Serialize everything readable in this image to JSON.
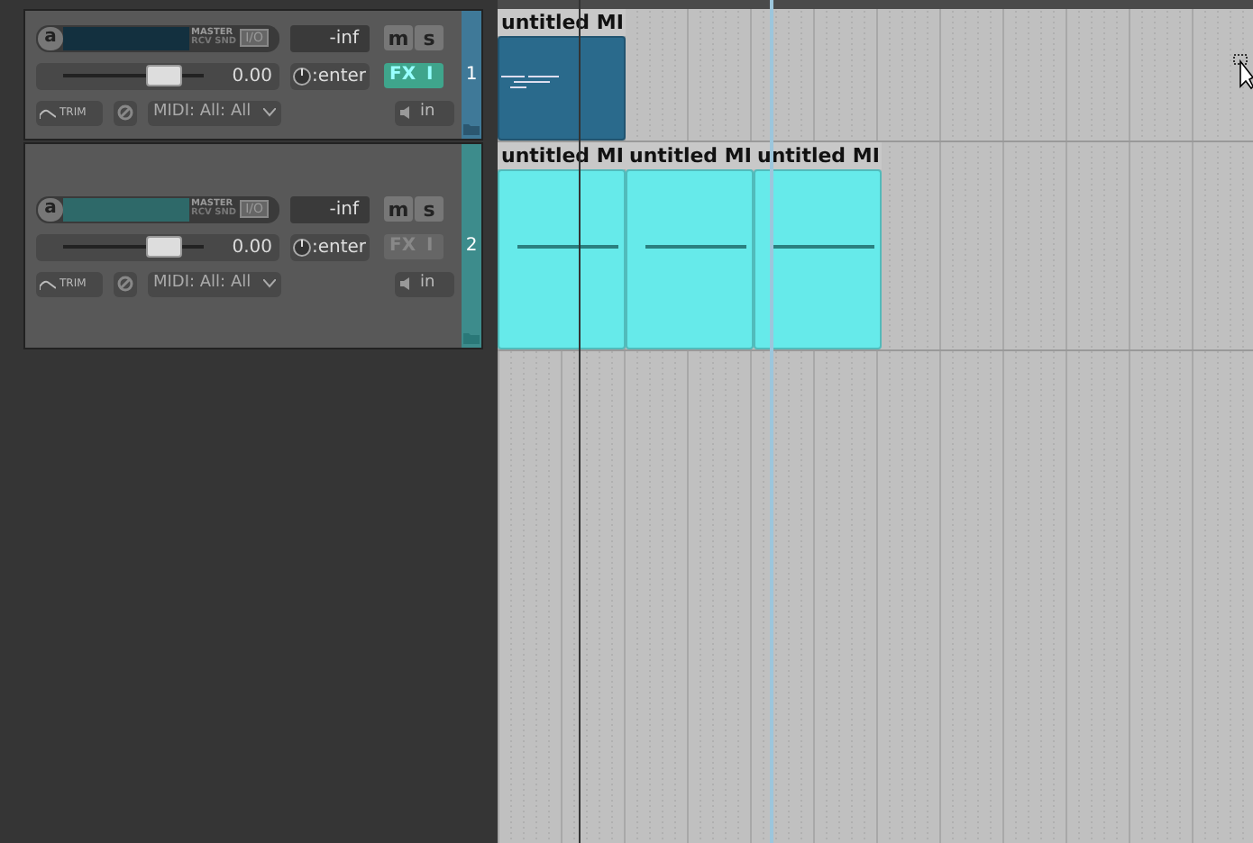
{
  "tracks": [
    {
      "number": "1",
      "color": "#2a6a8c",
      "selected": true,
      "rec_label": "a",
      "master_label": "MASTER",
      "rcv_snd_label": "RCV SND",
      "io_label": "I/O",
      "peak": "-inf",
      "mute": "m",
      "solo": "s",
      "volume": "0.00",
      "level": 0.72,
      "input": ":enter",
      "fx": "FX",
      "fx_bypass": "I",
      "fx_on": true,
      "trim": "TRIM",
      "midi": "MIDI: All: All",
      "monitor": "in",
      "items": [
        {
          "label": "untitled MI",
          "kind": "notes"
        }
      ]
    },
    {
      "number": "2",
      "color": "#66eaea",
      "selected": false,
      "rec_label": "a",
      "master_label": "MASTER",
      "rcv_snd_label": "RCV SND",
      "io_label": "I/O",
      "peak": "-inf",
      "mute": "m",
      "solo": "s",
      "volume": "0.00",
      "level": 0.72,
      "input": ":enter",
      "fx": "FX",
      "fx_bypass": "I",
      "fx_on": false,
      "trim": "TRIM",
      "midi": "MIDI: All: All",
      "monitor": "in",
      "items": [
        {
          "label": "untitled MI",
          "kind": "line"
        },
        {
          "label": "untitled MI",
          "kind": "line"
        },
        {
          "label": "untitled MI",
          "kind": "line"
        }
      ]
    }
  ]
}
